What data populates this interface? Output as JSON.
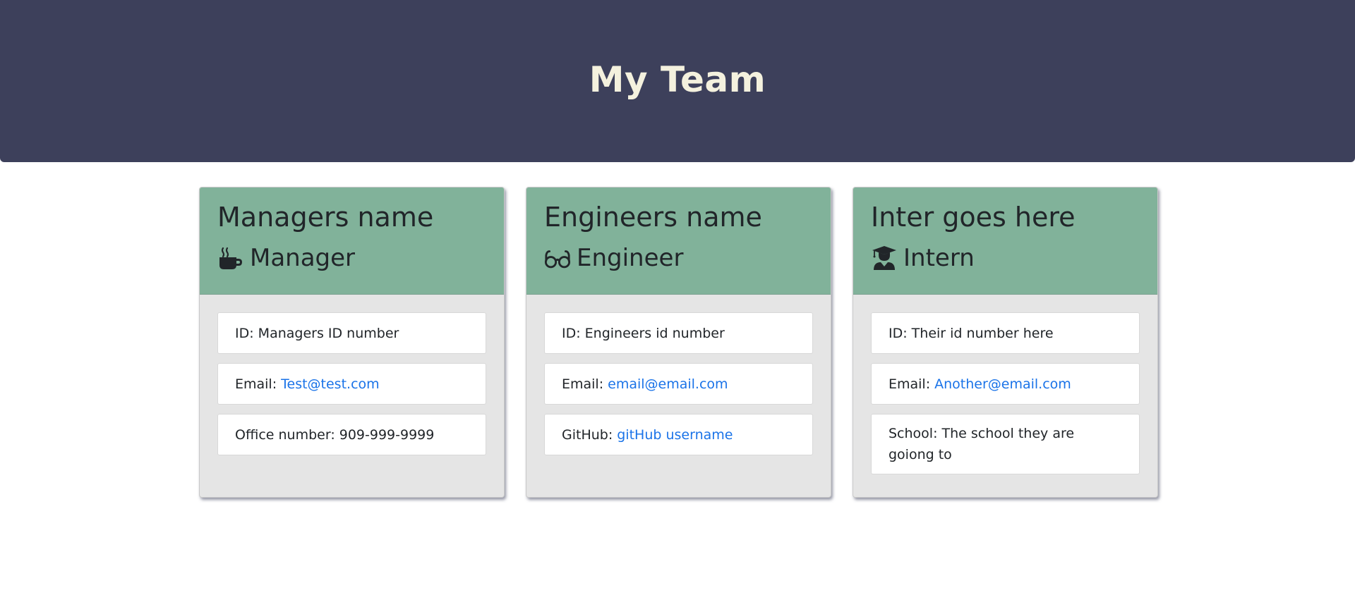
{
  "header": {
    "title": "My Team"
  },
  "colors": {
    "header_bg": "#3d405b",
    "header_text": "#f4f1de",
    "card_header_bg": "#81b29a",
    "card_body_bg": "#e5e5e5",
    "link": "#1a73e8"
  },
  "cards": [
    {
      "name": "Managers name",
      "role": "Manager",
      "role_icon": "coffee-mug-icon",
      "id_label": "ID: Managers ID number",
      "email_prefix": "Email:",
      "email": "Test@test.com",
      "extra_label": "Office number: 909-999-9999"
    },
    {
      "name": "Engineers name",
      "role": "Engineer",
      "role_icon": "glasses-icon",
      "id_label": "ID: Engineers id number",
      "email_prefix": "Email:",
      "email": "email@email.com",
      "extra_prefix": "GitHub:",
      "extra_link": "gitHub username"
    },
    {
      "name": "Inter goes here",
      "role": "Intern",
      "role_icon": "graduate-icon",
      "id_label": "ID: Their id number here",
      "email_prefix": "Email:",
      "email": "Another@email.com",
      "extra_label": "School: The school they are goiong to"
    }
  ]
}
